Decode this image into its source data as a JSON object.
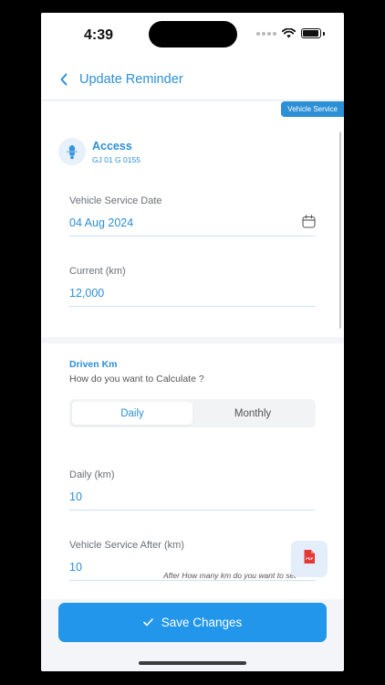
{
  "status_bar": {
    "time": "4:39"
  },
  "header": {
    "title": "Update Reminder"
  },
  "tag": "Vehicle Service",
  "vehicle": {
    "name": "Access",
    "plate": "GJ 01 G 0155"
  },
  "fields": {
    "service_date": {
      "label": "Vehicle Service Date",
      "value": "04 Aug 2024"
    },
    "current_km": {
      "label": "Current (km)",
      "value": "12,000"
    },
    "daily_km": {
      "label": "Daily (km)",
      "value": "10"
    },
    "service_after_km": {
      "label": "Vehicle Service After (km)",
      "value": "10"
    }
  },
  "driven": {
    "title": "Driven Km",
    "question": "How do you want to Calculate ?",
    "options": [
      "Daily",
      "Monthly"
    ],
    "selected": "Daily"
  },
  "hint": "After How many km do you want to set",
  "save_button": "Save Changes",
  "colors": {
    "accent": "#2d8fd6",
    "button": "#2196ea"
  },
  "icons": {
    "back": "chevron-left-icon",
    "calendar": "calendar-icon",
    "avatar": "scooter-icon",
    "pdf": "pdf-icon",
    "save": "check-icon"
  }
}
